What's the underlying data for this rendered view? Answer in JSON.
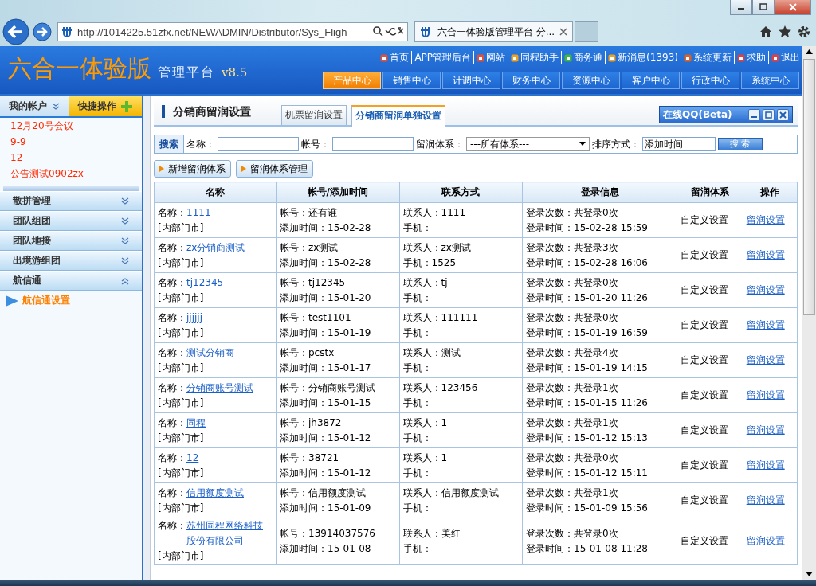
{
  "browser": {
    "address": "http://1014225.51zfx.net/NEWADMIN/Distributor/Sys_Fligh",
    "tab_title": "六合一体验版管理平台 分..."
  },
  "header": {
    "logo": "六合一体验版",
    "subtitle": "管理平台",
    "version": "v8.5",
    "links": [
      {
        "label": "首页",
        "kind": "home"
      },
      {
        "label": "APP管理后台",
        "kind": "plain"
      },
      {
        "label": "网站",
        "kind": "home"
      },
      {
        "label": "同程助手",
        "kind": "star"
      },
      {
        "label": "商务通",
        "kind": "chat"
      },
      {
        "label": "新消息(1393)",
        "kind": "mail"
      },
      {
        "label": "系统更新",
        "kind": "update"
      },
      {
        "label": "求助",
        "kind": "help"
      },
      {
        "label": "退出",
        "kind": "exit"
      }
    ],
    "tabs": [
      {
        "label": "产品中心",
        "selected": true
      },
      {
        "label": "销售中心",
        "selected": false
      },
      {
        "label": "计调中心",
        "selected": false
      },
      {
        "label": "财务中心",
        "selected": false
      },
      {
        "label": "资源中心",
        "selected": false
      },
      {
        "label": "客户中心",
        "selected": false
      },
      {
        "label": "行政中心",
        "selected": false
      },
      {
        "label": "系统中心",
        "selected": false
      }
    ]
  },
  "sidebar": {
    "account": "我的帐户",
    "quick": "快捷操作",
    "notices": [
      "12月20号会议",
      "9-9",
      "12",
      "公告测试0902zx"
    ],
    "groups": [
      {
        "label": "散拼管理",
        "expanded": false
      },
      {
        "label": "团队组团",
        "expanded": false
      },
      {
        "label": "团队地接",
        "expanded": false
      },
      {
        "label": "出境游组团",
        "expanded": false
      },
      {
        "label": "航信通",
        "expanded": true,
        "children": [
          {
            "label": "航信通设置"
          }
        ]
      }
    ]
  },
  "page": {
    "title": "分销商留润设置",
    "tabs": [
      {
        "label": "机票留润设置",
        "selected": false
      },
      {
        "label": "分销商留润单独设置",
        "selected": true
      }
    ]
  },
  "search": {
    "label": "搜索",
    "name_label": "名称：",
    "account_label": "帐号：",
    "scheme_label": "留润体系：",
    "scheme_value": "---所有体系---",
    "sort_label": "排序方式：",
    "sort_value": "添加时间",
    "button": "搜 索"
  },
  "actions": [
    "新增留润体系",
    "留润体系管理"
  ],
  "qq": {
    "title": "在线QQ(Beta)"
  },
  "table": {
    "columns": [
      "名称",
      "帐号/添加时间",
      "联系方式",
      "登录信息",
      "留润体系",
      "操作"
    ],
    "rows": [
      {
        "name_label": "名称：",
        "name": "1111",
        "store": "[内部门市]",
        "account": "帐号：还有谁",
        "added": "添加时间：15-02-28",
        "contact": "联系人：1111",
        "phone": "手机：",
        "login_count": "登录次数：共登录0次",
        "login_time": "登录时间：15-02-28 15:59",
        "scheme": "自定义设置",
        "action": "留润设置"
      },
      {
        "name_label": "名称：",
        "name": "zx分销商测试",
        "store": "[内部门市]",
        "account": "帐号：zx测试",
        "added": "添加时间：15-02-28",
        "contact": "联系人：zx测试",
        "phone": "手机：1525",
        "login_count": "登录次数：共登录3次",
        "login_time": "登录时间：15-02-28 16:06",
        "scheme": "自定义设置",
        "action": "留润设置"
      },
      {
        "name_label": "名称：",
        "name": "tj12345",
        "store": "[内部门市]",
        "account": "帐号：tj12345",
        "added": "添加时间：15-01-20",
        "contact": "联系人：tj",
        "phone": "手机：",
        "login_count": "登录次数：共登录0次",
        "login_time": "登录时间：15-01-20 11:26",
        "scheme": "自定义设置",
        "action": "留润设置"
      },
      {
        "name_label": "名称：",
        "name": "jjjjjj",
        "store": "[内部门市]",
        "account": "帐号：test1101",
        "added": "添加时间：15-01-19",
        "contact": "联系人：111111",
        "phone": "手机：",
        "login_count": "登录次数：共登录0次",
        "login_time": "登录时间：15-01-19 16:59",
        "scheme": "自定义设置",
        "action": "留润设置"
      },
      {
        "name_label": "名称：",
        "name": "测试分销商",
        "store": "[内部门市]",
        "account": "帐号：pcstx",
        "added": "添加时间：15-01-17",
        "contact": "联系人：测试",
        "phone": "手机：",
        "login_count": "登录次数：共登录4次",
        "login_time": "登录时间：15-01-19 14:15",
        "scheme": "自定义设置",
        "action": "留润设置"
      },
      {
        "name_label": "名称：",
        "name": "分销商账号测试",
        "store": "[内部门市]",
        "account": "帐号：分销商账号测试",
        "added": "添加时间：15-01-15",
        "contact": "联系人：123456",
        "phone": "手机：",
        "login_count": "登录次数：共登录1次",
        "login_time": "登录时间：15-01-15 11:26",
        "scheme": "自定义设置",
        "action": "留润设置"
      },
      {
        "name_label": "名称：",
        "name": "同程",
        "store": "[内部门市]",
        "account": "帐号：jh3872",
        "added": "添加时间：15-01-12",
        "contact": "联系人：1",
        "phone": "手机：",
        "login_count": "登录次数：共登录1次",
        "login_time": "登录时间：15-01-12 15:13",
        "scheme": "自定义设置",
        "action": "留润设置"
      },
      {
        "name_label": "名称：",
        "name": "12",
        "store": "[内部门市]",
        "account": "帐号：38721",
        "added": "添加时间：15-01-12",
        "contact": "联系人：1",
        "phone": "手机：",
        "login_count": "登录次数：共登录0次",
        "login_time": "登录时间：15-01-12 15:11",
        "scheme": "自定义设置",
        "action": "留润设置"
      },
      {
        "name_label": "名称：",
        "name": "信用额度测试",
        "store": "[内部门市]",
        "account": "帐号：信用额度测试",
        "added": "添加时间：15-01-09",
        "contact": "联系人：信用额度测试",
        "phone": "手机：",
        "login_count": "登录次数：共登录1次",
        "login_time": "登录时间：15-01-09 15:56",
        "scheme": "自定义设置",
        "action": "留润设置"
      },
      {
        "name_label": "名称：",
        "name": "苏州同程网络科技股份有限公司",
        "store": "[内部门市]",
        "account": "帐号：13914037576",
        "added": "添加时间：15-01-08",
        "contact": "联系人：美红",
        "phone": "手机：",
        "login_count": "登录次数：共登录0次",
        "login_time": "登录时间：15-01-08 11:28",
        "scheme": "自定义设置",
        "action": "留润设置"
      }
    ]
  }
}
